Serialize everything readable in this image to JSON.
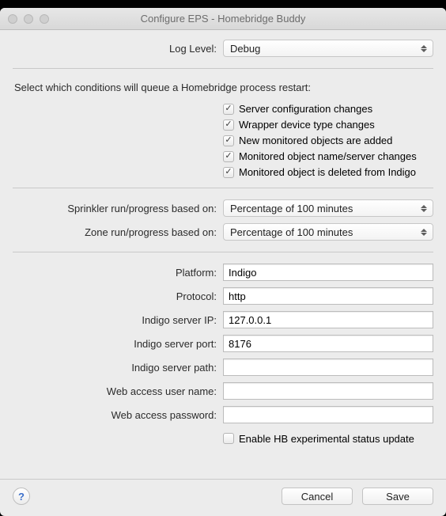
{
  "window": {
    "title": "Configure EPS - Homebridge Buddy"
  },
  "log_level": {
    "label": "Log Level:",
    "value": "Debug"
  },
  "restart_instruction": "Select which conditions will queue a Homebridge process restart:",
  "restart_conditions": [
    {
      "label": "Server configuration changes",
      "checked": true
    },
    {
      "label": "Wrapper device type changes",
      "checked": true
    },
    {
      "label": "New monitored objects are added",
      "checked": true
    },
    {
      "label": "Monitored object name/server changes",
      "checked": true
    },
    {
      "label": "Monitored object is deleted from Indigo",
      "checked": true
    }
  ],
  "sprinkler": {
    "label": "Sprinkler run/progress based on:",
    "value": "Percentage of 100 minutes"
  },
  "zone": {
    "label": "Zone run/progress based on:",
    "value": "Percentage of 100 minutes"
  },
  "fields": {
    "platform": {
      "label": "Platform:",
      "value": "Indigo"
    },
    "protocol": {
      "label": "Protocol:",
      "value": "http"
    },
    "server_ip": {
      "label": "Indigo server IP:",
      "value": "127.0.0.1"
    },
    "server_port": {
      "label": "Indigo server port:",
      "value": "8176"
    },
    "server_path": {
      "label": "Indigo server path:",
      "value": ""
    },
    "web_user": {
      "label": "Web access user name:",
      "value": ""
    },
    "web_pass": {
      "label": "Web access password:",
      "value": ""
    }
  },
  "experimental": {
    "label": "Enable HB experimental status update",
    "checked": false
  },
  "buttons": {
    "help": "?",
    "cancel": "Cancel",
    "save": "Save"
  }
}
